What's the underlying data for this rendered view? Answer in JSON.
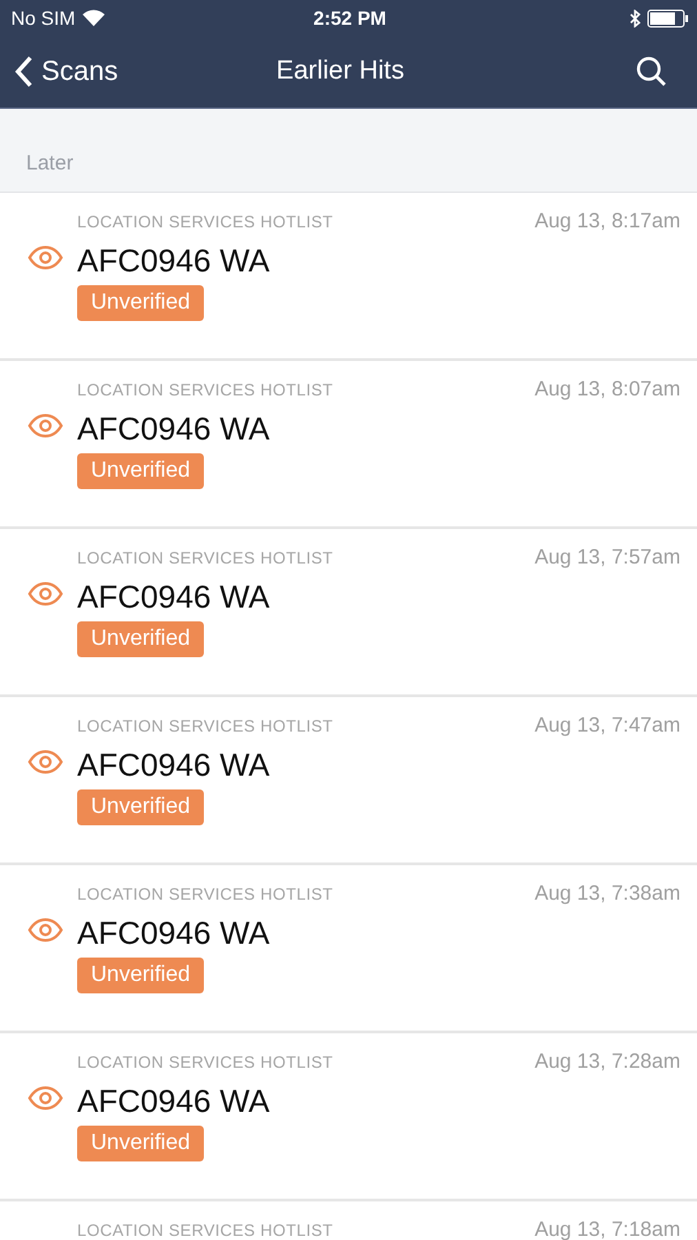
{
  "status_bar": {
    "carrier": "No SIM",
    "time": "2:52 PM"
  },
  "nav": {
    "back": "Scans",
    "title": "Earlier Hits"
  },
  "section": "Later",
  "hits": [
    {
      "list": "LOCATION SERVICES HOTLIST",
      "time": "Aug 13, 8:17am",
      "plate": "AFC0946 WA",
      "badge": "Unverified"
    },
    {
      "list": "LOCATION SERVICES HOTLIST",
      "time": "Aug 13, 8:07am",
      "plate": "AFC0946 WA",
      "badge": "Unverified"
    },
    {
      "list": "LOCATION SERVICES HOTLIST",
      "time": "Aug 13, 7:57am",
      "plate": "AFC0946 WA",
      "badge": "Unverified"
    },
    {
      "list": "LOCATION SERVICES HOTLIST",
      "time": "Aug 13, 7:47am",
      "plate": "AFC0946 WA",
      "badge": "Unverified"
    },
    {
      "list": "LOCATION SERVICES HOTLIST",
      "time": "Aug 13, 7:38am",
      "plate": "AFC0946 WA",
      "badge": "Unverified"
    },
    {
      "list": "LOCATION SERVICES HOTLIST",
      "time": "Aug 13, 7:28am",
      "plate": "AFC0946 WA",
      "badge": "Unverified"
    },
    {
      "list": "LOCATION SERVICES HOTLIST",
      "time": "Aug 13, 7:18am"
    }
  ]
}
